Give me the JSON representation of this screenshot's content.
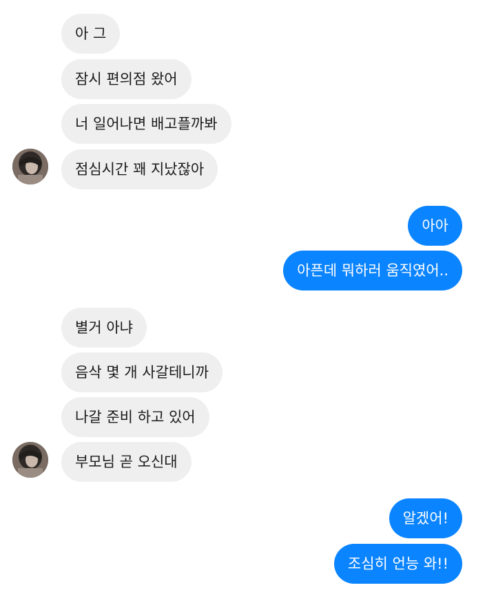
{
  "conversation": {
    "incoming_group_1": [
      "아 그",
      "잠시 편의점 왔어",
      "너 일어나면 배고플까봐",
      "점심시간 꽤 지났잖아"
    ],
    "outgoing_group_1": [
      "아아",
      "아픈데 뭐하러 움직였어.."
    ],
    "incoming_group_2": [
      "별거 아냐",
      "음삭 몇 개 사갈테니까",
      "나갈 준비 하고 있어",
      "부모님 곧 오신대"
    ],
    "outgoing_group_2": [
      "알겠어!",
      "조심히 언능 와!!"
    ]
  },
  "icons": {
    "contact_avatar": "profile-photo-avatar"
  },
  "colors": {
    "incoming_bubble": "#efeff0",
    "outgoing_bubble": "#0b84ff",
    "incoming_text": "#1a1a1a",
    "outgoing_text": "#ffffff",
    "background": "#ffffff"
  }
}
